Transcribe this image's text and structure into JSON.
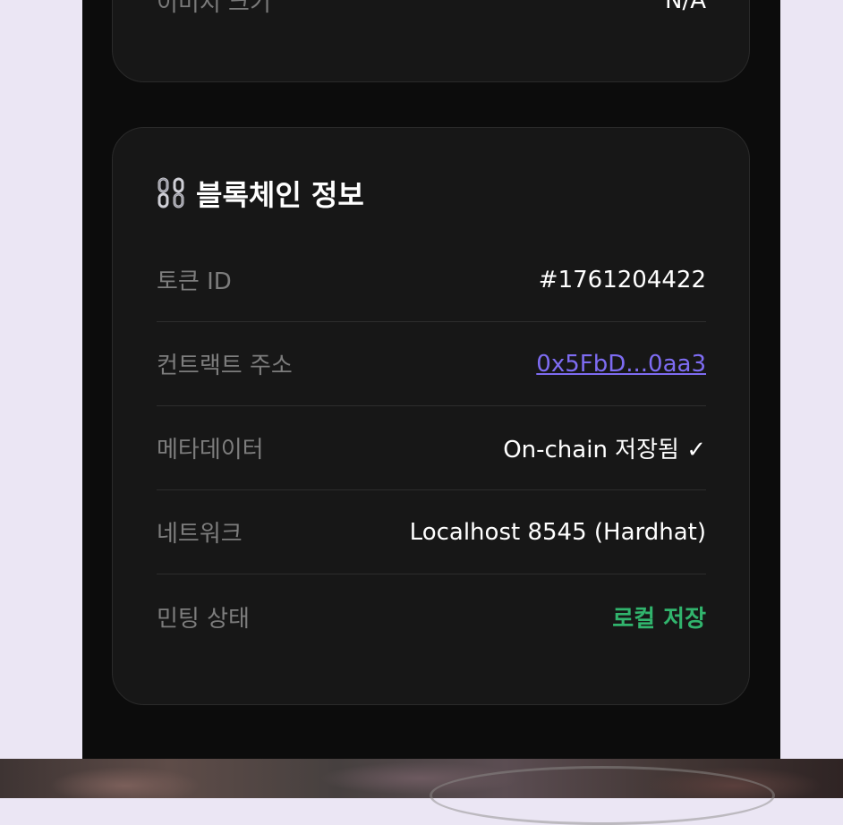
{
  "top_card": {
    "label": "이미지 크기",
    "value": "N/A"
  },
  "blockchain_card": {
    "icon": "chain-icon",
    "title": "블록체인 정보",
    "rows": [
      {
        "label": "토큰 ID",
        "value": "#1761204422"
      },
      {
        "label": "컨트랙트 주소",
        "value": "0x5FbD...0aa3"
      },
      {
        "label": "메타데이터",
        "value": "On-chain 저장됨 ✓"
      },
      {
        "label": "네트워크",
        "value": "Localhost 8545 (Hardhat)"
      },
      {
        "label": "민팅 상태",
        "value": "로컬 저장"
      }
    ]
  },
  "colors": {
    "link": "#7e6cf2",
    "status_ok": "#31b46d",
    "card_bg": "#171717",
    "panel_bg": "#0c0c0c",
    "page_bg": "#ebe6f4"
  }
}
